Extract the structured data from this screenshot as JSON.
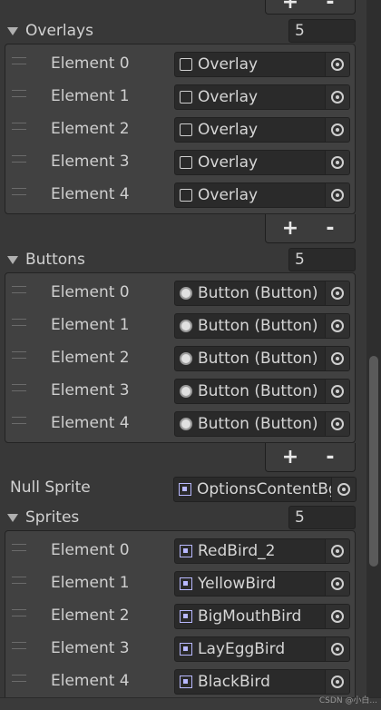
{
  "groups": [
    {
      "label": "Overlays",
      "size": "5",
      "icon": "gameobject-cube-icon",
      "items": [
        {
          "label": "Element 0",
          "value": "Overlay"
        },
        {
          "label": "Element 1",
          "value": "Overlay"
        },
        {
          "label": "Element 2",
          "value": "Overlay"
        },
        {
          "label": "Element 3",
          "value": "Overlay"
        },
        {
          "label": "Element 4",
          "value": "Overlay"
        }
      ]
    },
    {
      "label": "Buttons",
      "size": "5",
      "icon": "button-radio-icon",
      "items": [
        {
          "label": "Element 0",
          "value": "Button (Button)"
        },
        {
          "label": "Element 1",
          "value": "Button (Button)"
        },
        {
          "label": "Element 2",
          "value": "Button (Button)"
        },
        {
          "label": "Element 3",
          "value": "Button (Button)"
        },
        {
          "label": "Element 4",
          "value": "Button (Button)"
        }
      ]
    },
    {
      "label": "Sprites",
      "size": "5",
      "icon": "sprite-icon",
      "items": [
        {
          "label": "Element 0",
          "value": "RedBird_2"
        },
        {
          "label": "Element 1",
          "value": "YellowBird"
        },
        {
          "label": "Element 2",
          "value": "BigMouthBird"
        },
        {
          "label": "Element 3",
          "value": "LayEggBird"
        },
        {
          "label": "Element 4",
          "value": "BlackBird"
        }
      ]
    }
  ],
  "null_sprite": {
    "label": "Null Sprite",
    "value": "OptionsContentBg",
    "icon": "sprite-icon"
  },
  "buttons": {
    "add": "+",
    "remove": "-"
  },
  "watermark": "CSDN @小白..."
}
